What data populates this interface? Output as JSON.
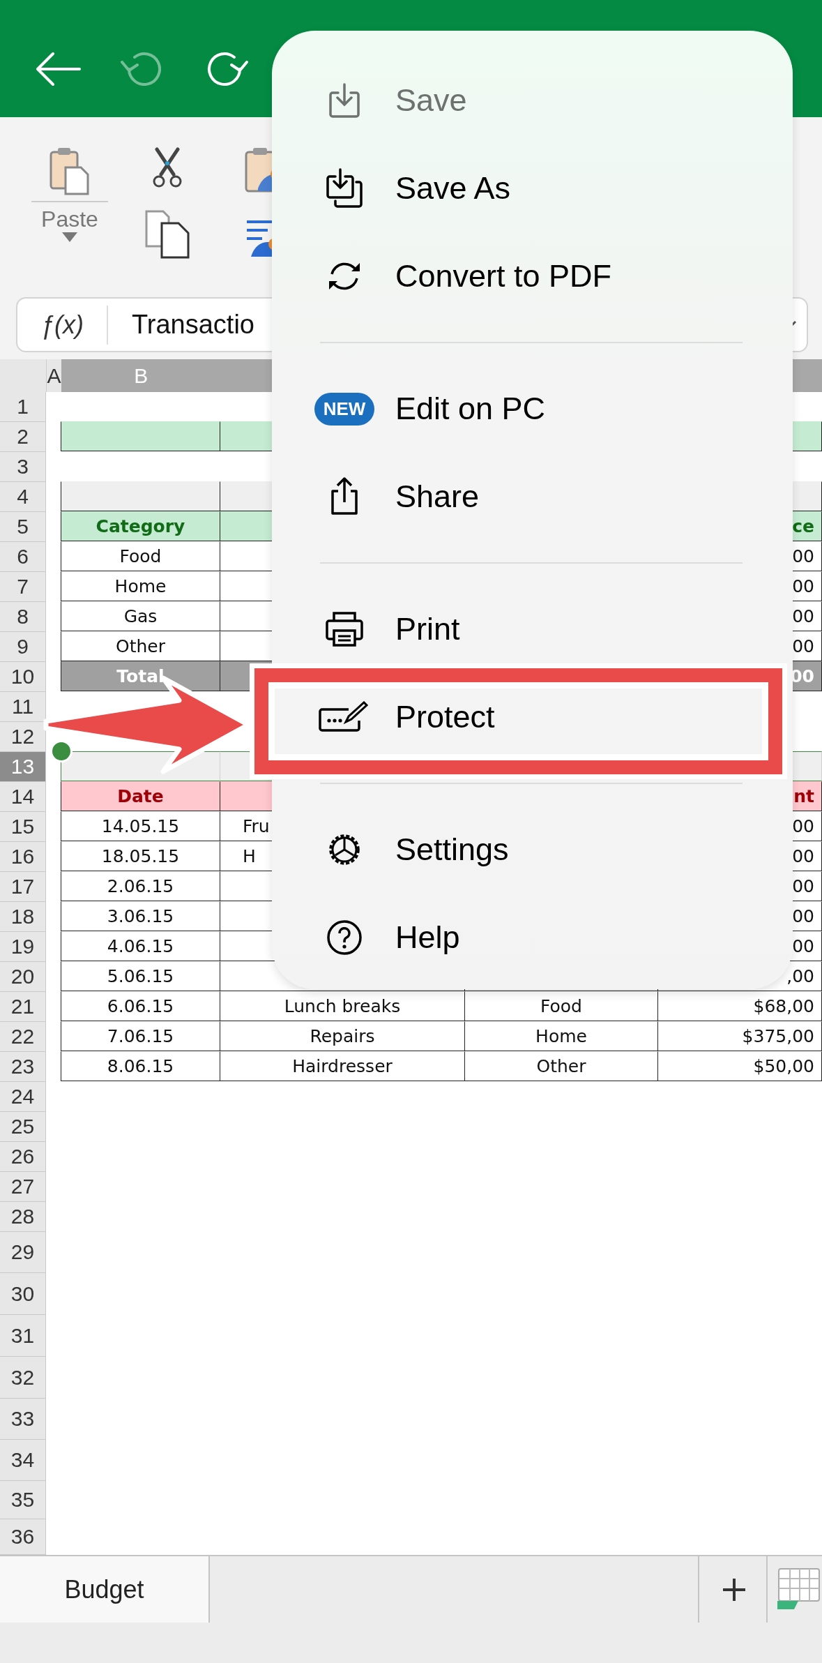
{
  "toolbar": {
    "undo": {
      "disabled": true
    },
    "redo": {
      "disabled": false
    }
  },
  "ribbon": {
    "paste_label": "Paste"
  },
  "formula_bar": {
    "function_label": "ƒ(x)",
    "value": "Transactio"
  },
  "sheet": {
    "columns": [
      {
        "label": "A",
        "selected": false
      },
      {
        "label": "B",
        "selected": true
      },
      {
        "selected": true
      },
      {},
      {
        "selected": true
      }
    ],
    "rows": [
      {
        "number": "1",
        "selected": false,
        "kind": "blank"
      },
      {
        "number": "2",
        "selected": false,
        "kind": "title"
      },
      {
        "number": "3",
        "selected": false,
        "kind": "blank"
      },
      {
        "number": "4",
        "selected": false,
        "kind": "band"
      },
      {
        "number": "5",
        "selected": false,
        "kind": "head_green",
        "col_b": "Category",
        "col_e": "ce"
      },
      {
        "number": "6",
        "selected": false,
        "kind": "data",
        "col_b": "Food",
        "col_e": "00"
      },
      {
        "number": "7",
        "selected": false,
        "kind": "data",
        "col_b": "Home",
        "col_e": "00"
      },
      {
        "number": "8",
        "selected": false,
        "kind": "data",
        "col_b": "Gas",
        "col_e": "00"
      },
      {
        "number": "9",
        "selected": false,
        "kind": "data",
        "col_b": "Other",
        "col_e": "00"
      },
      {
        "number": "10",
        "selected": false,
        "kind": "total",
        "col_b": "Total",
        "col_e": "00"
      },
      {
        "number": "11",
        "selected": false,
        "kind": "blank"
      },
      {
        "number": "12",
        "selected": false,
        "kind": "blank"
      },
      {
        "number": "13",
        "selected": true,
        "kind": "band"
      },
      {
        "number": "14",
        "selected": false,
        "kind": "head_red",
        "col_b": "Date",
        "col_e": "nt"
      },
      {
        "number": "15",
        "selected": false,
        "kind": "data",
        "col_b": "14.05.15",
        "col_c": "Fru",
        "col_c_covered": true,
        "col_e": "00"
      },
      {
        "number": "16",
        "selected": false,
        "kind": "data",
        "col_b": "18.05.15",
        "col_c": "H",
        "col_c_covered": true,
        "col_e": "00"
      },
      {
        "number": "17",
        "selected": false,
        "kind": "data",
        "col_b": "2.06.15",
        "col_e": "00"
      },
      {
        "number": "18",
        "selected": false,
        "kind": "data",
        "col_b": "3.06.15",
        "col_e": "00"
      },
      {
        "number": "19",
        "selected": false,
        "kind": "data",
        "col_b": "4.06.15",
        "col_e": "00"
      },
      {
        "number": "20",
        "selected": false,
        "kind": "data",
        "col_b": "5.06.15",
        "col_e": ",00"
      },
      {
        "number": "21",
        "selected": false,
        "kind": "data",
        "col_b": "6.06.15",
        "col_c": "Lunch breaks",
        "col_d": "Food",
        "col_e": "$68,00"
      },
      {
        "number": "22",
        "selected": false,
        "kind": "data",
        "col_b": "7.06.15",
        "col_c": "Repairs",
        "col_d": "Home",
        "col_e": "$375,00"
      },
      {
        "number": "23",
        "selected": false,
        "kind": "data",
        "col_b": "8.06.15",
        "col_c": "Hairdresser",
        "col_d": "Other",
        "col_e": "$50,00"
      },
      {
        "number": "24",
        "selected": false,
        "kind": "blank"
      },
      {
        "number": "25",
        "selected": false,
        "kind": "blank"
      },
      {
        "number": "26",
        "selected": false,
        "kind": "blank"
      },
      {
        "number": "27",
        "selected": false,
        "kind": "blank"
      },
      {
        "number": "28",
        "selected": false,
        "kind": "blank"
      },
      {
        "number": "29",
        "selected": false,
        "kind": "blank"
      },
      {
        "number": "30",
        "selected": false,
        "kind": "blank"
      },
      {
        "number": "31",
        "selected": false,
        "kind": "blank"
      },
      {
        "number": "32",
        "selected": false,
        "kind": "blank"
      },
      {
        "number": "33",
        "selected": false,
        "kind": "blank"
      },
      {
        "number": "34",
        "selected": false,
        "kind": "blank"
      },
      {
        "number": "35",
        "selected": false,
        "kind": "blank"
      },
      {
        "number": "36",
        "selected": false,
        "kind": "blank"
      }
    ]
  },
  "menu": {
    "groups": [
      [
        {
          "kind": "save",
          "label": "Save",
          "disabled": true
        },
        {
          "kind": "save_as",
          "label": "Save As",
          "disabled": false
        },
        {
          "kind": "convert",
          "label": "Convert to PDF",
          "disabled": false
        }
      ],
      [
        {
          "kind": "edit",
          "label": "Edit on PC",
          "disabled": false,
          "badge": "NEW"
        },
        {
          "kind": "share",
          "label": "Share",
          "disabled": false
        }
      ],
      [
        {
          "kind": "print",
          "label": "Print",
          "disabled": false
        },
        {
          "kind": "protect",
          "label": "Protect",
          "disabled": false
        }
      ],
      [
        {
          "kind": "settings",
          "label": "Settings",
          "disabled": false
        },
        {
          "kind": "help",
          "label": "Help",
          "disabled": false
        }
      ]
    ]
  },
  "sheet_tabs": [
    {
      "label": "Budget",
      "selected": true
    }
  ]
}
